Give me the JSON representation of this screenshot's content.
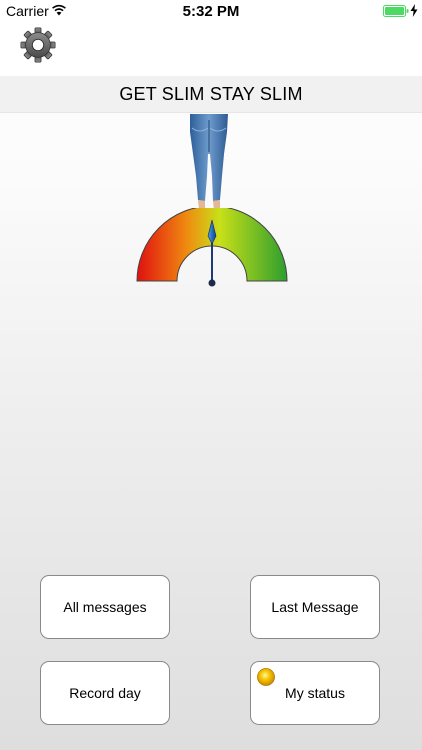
{
  "status_bar": {
    "carrier": "Carrier",
    "time": "5:32 PM",
    "battery_color": "#4cd964"
  },
  "header": {
    "settings_icon": "gear-icon"
  },
  "title": "GET SLIM STAY SLIM",
  "gauge": {
    "colors": [
      "#e01010",
      "#f08a10",
      "#c8e018",
      "#2e9e2e"
    ],
    "needle_level": 0.5
  },
  "buttons": {
    "all_messages": "All messages",
    "last_message": "Last Message",
    "record_day": "Record day",
    "my_status": "My status"
  },
  "indicator": {
    "icon": "status-dot-icon",
    "color": "#f6c500"
  }
}
